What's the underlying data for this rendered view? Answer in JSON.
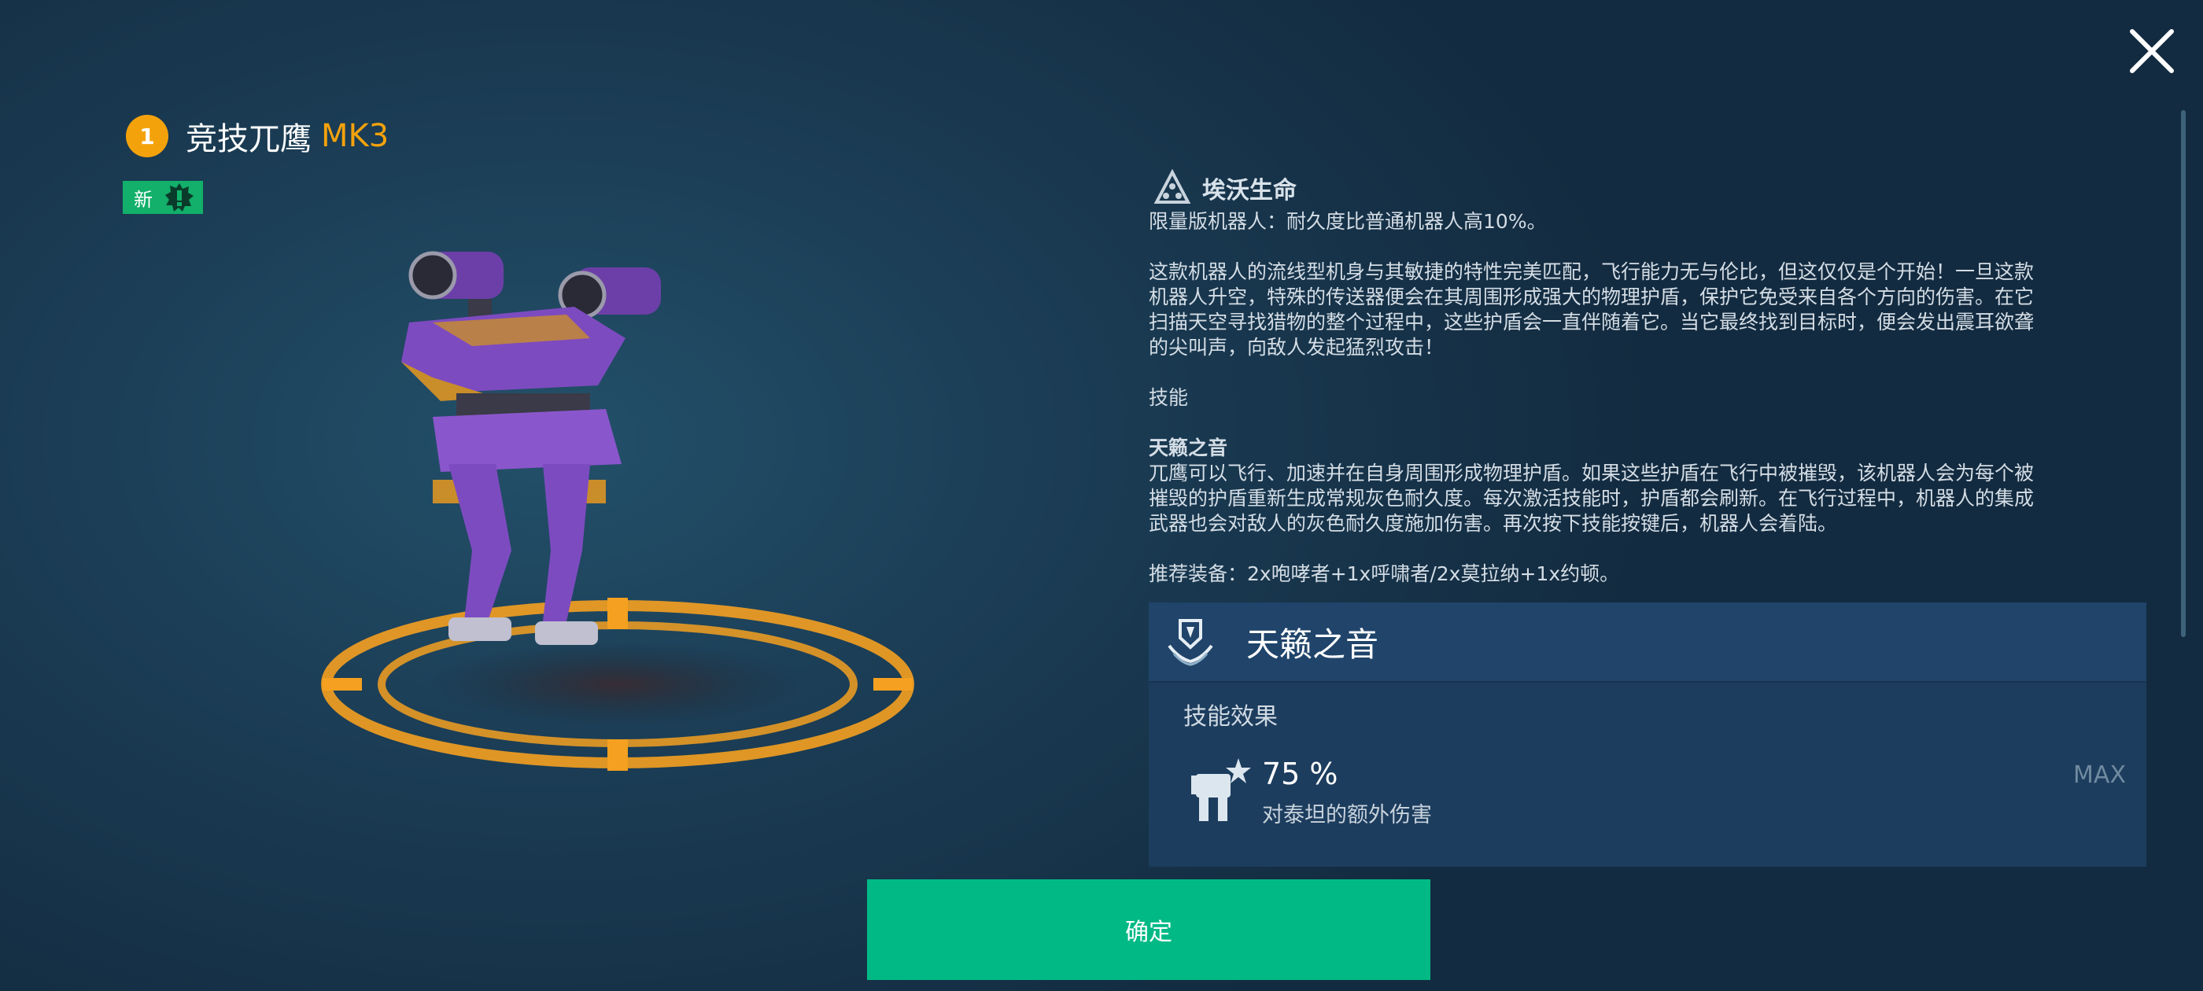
{
  "header": {
    "rank": "1",
    "name": "竞技兀鹰",
    "mk": "MK3",
    "new_tag": "新"
  },
  "close": {
    "icon": "close-icon"
  },
  "description": {
    "faction_icon": "ether-faction-icon",
    "faction": "埃沃生命",
    "limited": "限量版机器人：耐久度比普通机器人高10%。",
    "lore_lines": [
      "这款机器人的流线型机身与其敏捷的特性完美匹配，飞行能力无与伦比，但这仅仅是个开始！一旦这款",
      "机器人升空，特殊的传送器便会在其周围形成强大的物理护盾，保护它免受来自各个方向的伤害。在它",
      "扫描天空寻找猎物的整个过程中，这些护盾会一直伴随着它。当它最终找到目标时，便会发出震耳欲聋",
      "的尖叫声，向敌人发起猛烈攻击！"
    ],
    "skills_heading": "技能",
    "skill_name": "天籁之音",
    "skill_lines": [
      "兀鹰可以飞行、加速并在自身周围形成物理护盾。如果这些护盾在飞行中被摧毁，该机器人会为每个被",
      "摧毁的护盾重新生成常规灰色耐久度。每次激活技能时，护盾都会刷新。在飞行过程中，机器人的集成",
      "武器也会对敌人的灰色耐久度施加伤害。再次按下技能按键后，机器人会着陆。"
    ],
    "recommended": "推荐装备：2x咆哮者+1x呼啸者/2x莫拉纳+1x约顿。"
  },
  "ability": {
    "icon": "shield-wings-icon",
    "title": "天籁之音",
    "effect_label": "技能效果",
    "effect_icon": "titan-damage-icon",
    "effect_value": "75 %",
    "effect_desc": "对泰坦的额外伤害",
    "max_label": "MAX"
  },
  "confirm_label": "确定",
  "colors": {
    "accent": "#f4a20c",
    "confirm": "#00b985",
    "new_tag": "#12b06a",
    "robot_purple": "#8a4fc7"
  }
}
